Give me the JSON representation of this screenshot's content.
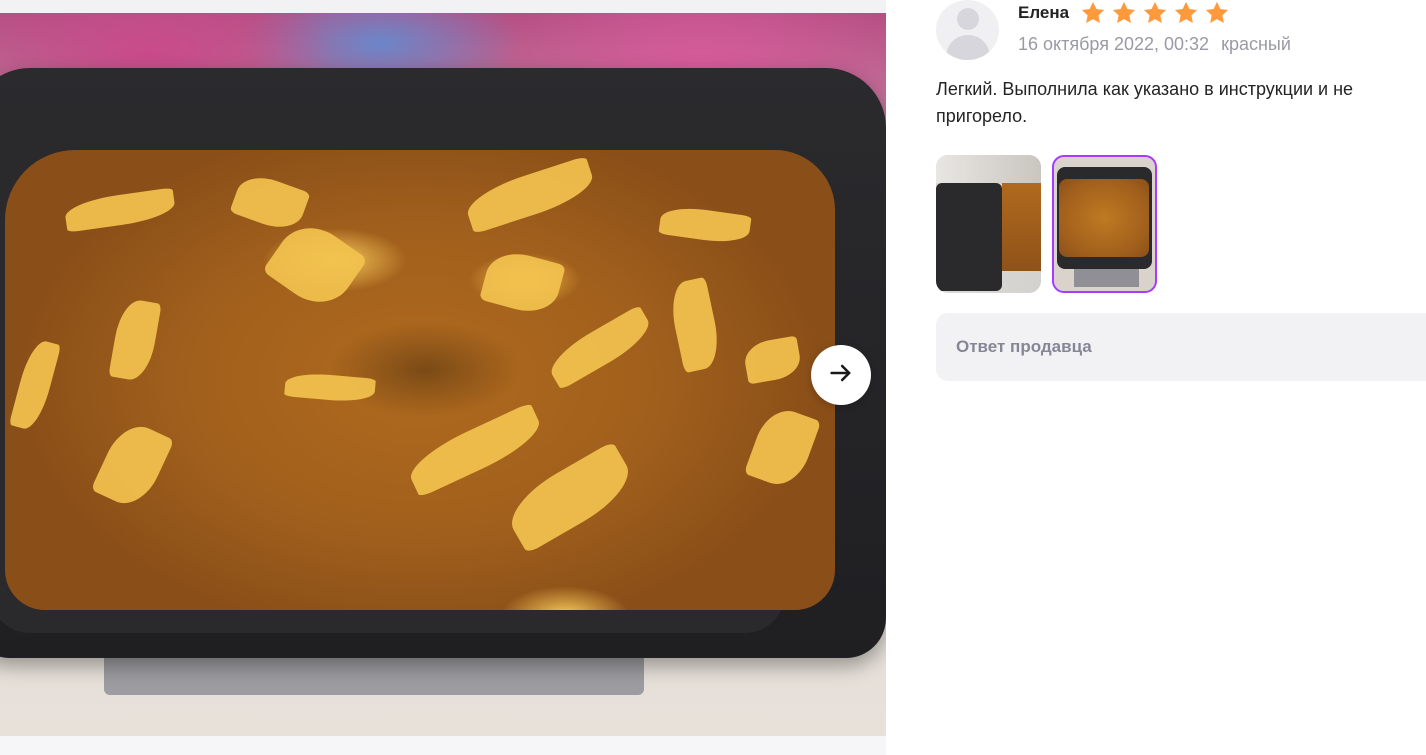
{
  "viewer": {
    "next_icon": "arrow-right-icon"
  },
  "review": {
    "author": "Елена",
    "rating": 5,
    "rating_max": 5,
    "star_color": "#ff9a3c",
    "date": "16 октября 2022, 00:32",
    "variant": "красный",
    "text": "Легкий. Выполнила как указано в инструкции и не пригорело.",
    "photos_count": 2,
    "selected_photo": 2,
    "selected_color": "#a73afd"
  },
  "seller_reply": {
    "label": "Ответ продавца"
  }
}
